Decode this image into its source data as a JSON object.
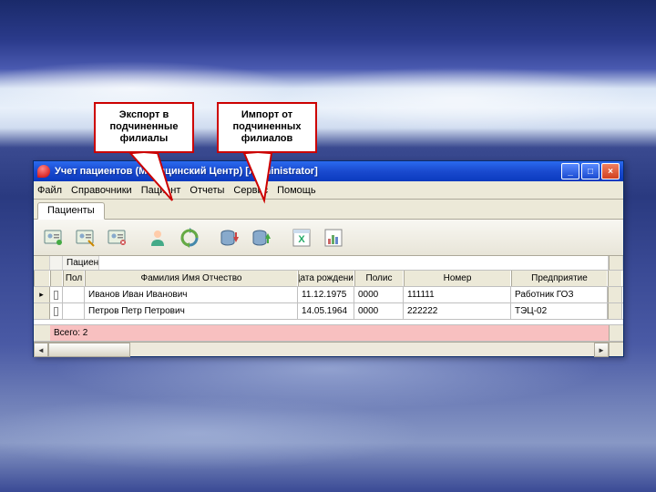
{
  "callouts": {
    "export": "Экспорт в\nподчиненные\nфилиалы",
    "import": "Импорт от\nподчиненных\nфилиалов"
  },
  "window": {
    "title": "Учет пациентов (Медицинский Центр) [Administrator]"
  },
  "menu": {
    "file": "Файл",
    "refs": "Справочники",
    "patient": "Пациент",
    "report": "Отчеты",
    "service": "Сервис",
    "help": "Помощь"
  },
  "tabs": {
    "patients": "Пациенты"
  },
  "filter": {
    "patient_label": "Пациент"
  },
  "headers": {
    "pol": "Пол",
    "fio": "Фамилия Имя Отчество",
    "date": "Дата рождения",
    "polis": "Полис",
    "nomer": "Номер",
    "pred": "Предприятие"
  },
  "rows": [
    {
      "fio": "Иванов Иван Иванович",
      "date": "11.12.1975",
      "polis": "0000",
      "nomer": "111111",
      "pred": "Работник ГОЗ"
    },
    {
      "fio": "Петров Петр Петрович",
      "date": "14.05.1964",
      "polis": "0000",
      "nomer": "222222",
      "pred": "ТЭЦ-02"
    }
  ],
  "footer": {
    "total": "Всего: 2"
  }
}
